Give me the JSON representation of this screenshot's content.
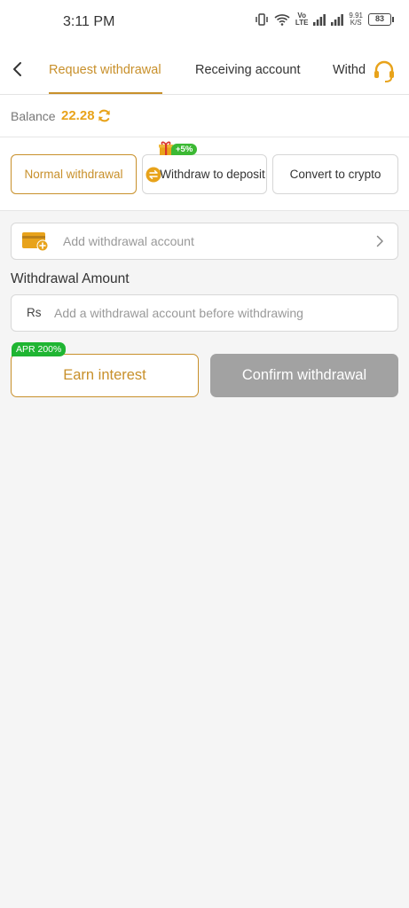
{
  "status_bar": {
    "time": "3:11 PM",
    "net_top": "Vo",
    "net_bottom": "LTE",
    "speed_value": "9.91",
    "speed_unit": "K/S",
    "battery": "83"
  },
  "tabs": [
    {
      "label": "Request withdrawal",
      "active": true
    },
    {
      "label": "Receiving account",
      "active": false
    },
    {
      "label": "Withd",
      "active": false
    }
  ],
  "icons": {
    "back": "chevron-left-icon",
    "support": "headset-icon",
    "refresh": "refresh-icon",
    "swap": "swap-icon",
    "gift": "gift-icon",
    "card": "card-add-icon",
    "chevron": "chevron-right-icon"
  },
  "balance": {
    "label": "Balance",
    "value": "22.28"
  },
  "withdraw_modes": [
    {
      "label": "Normal withdrawal",
      "active": true
    },
    {
      "label": "Withdraw to deposit",
      "active": false,
      "badge": "+5%"
    },
    {
      "label": "Convert to crypto",
      "active": false
    }
  ],
  "account": {
    "placeholder": "Add withdrawal account"
  },
  "amount": {
    "label": "Withdrawal Amount",
    "currency": "Rs",
    "placeholder": "Add a withdrawal account before withdrawing"
  },
  "actions": {
    "earn_label": "Earn interest",
    "apr_badge": "APR 200%",
    "confirm_label": "Confirm withdrawal"
  },
  "colors": {
    "accent": "#c8902b",
    "balance": "#e8a31b",
    "green_badge": "#1fb532",
    "disabled_button": "#a2a2a2",
    "background": "#f5f5f5"
  }
}
